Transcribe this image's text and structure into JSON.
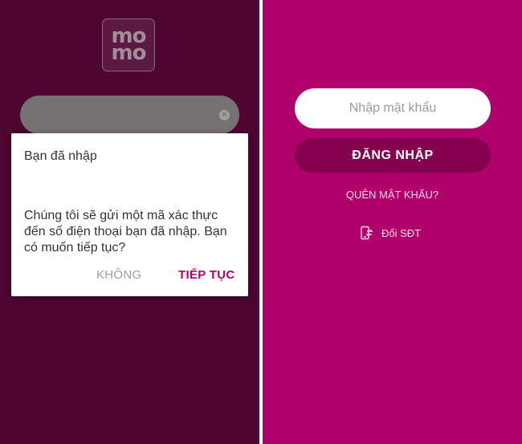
{
  "left_screen": {
    "logo": {
      "line1": "mo",
      "line2": "mo"
    },
    "phone_field": {
      "value": ""
    },
    "dialog": {
      "title": "Bạn đã nhập",
      "message": "Chúng tôi sẽ gửi một mã xác thực đến số điện thoại bạn đã nhập. Bạn có muốn tiếp tục?",
      "cancel_label": "KHÔNG",
      "continue_label": "TIẾP TỤC"
    }
  },
  "right_screen": {
    "password_placeholder": "Nhập mật khẩu",
    "login_label": "ĐĂNG NHẬP",
    "forgot_label": "QUÊN MẬT KHẨU?",
    "change_phone_label": "Đổi SĐT"
  },
  "colors": {
    "brand": "#b0006b",
    "overlay_background": "#4e0532",
    "login_button": "#85004f"
  }
}
